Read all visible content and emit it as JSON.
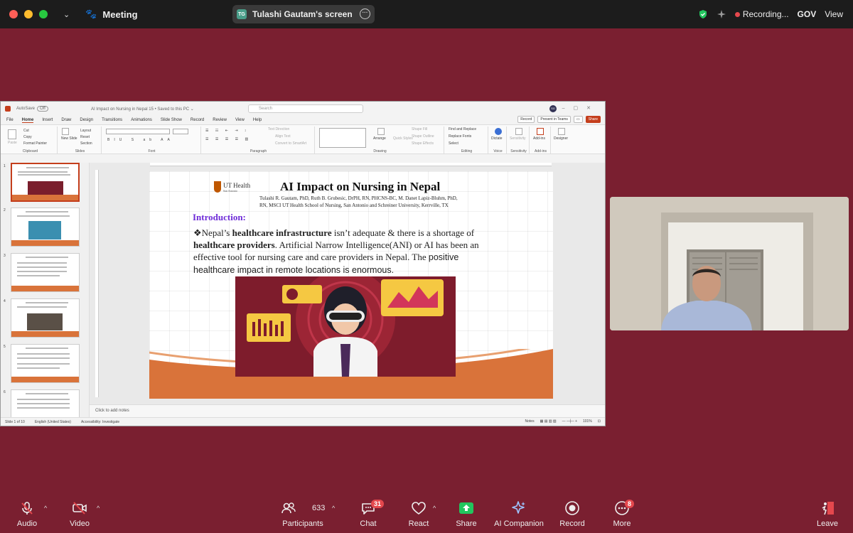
{
  "topbar": {
    "meeting_label": "Meeting",
    "share_initials": "TG",
    "share_label": "Tulashi Gautam's screen",
    "recording_label": "Recording...",
    "gov_label": "GOV",
    "view_label": "View"
  },
  "ppt": {
    "autosave_label": "AutoSave",
    "autosave_state": "Off",
    "doc_title": "AI Impact on Nursing in Nepal 15 • Saved to this PC ⌄",
    "search_placeholder": "Search",
    "user_initials": "SG",
    "menu": [
      "File",
      "Home",
      "Insert",
      "Draw",
      "Design",
      "Transitions",
      "Animations",
      "Slide Show",
      "Record",
      "Review",
      "View",
      "Help"
    ],
    "active_menu": "Home",
    "record_btn": "Record",
    "present_btn": "Present in Teams",
    "share_btn": "Share",
    "ribbon": {
      "clipboard": "Clipboard",
      "paste": "Paste",
      "cut": "Cut",
      "copy": "Copy",
      "format_painter": "Format Painter",
      "new_slide": "New Slide",
      "layout": "Layout",
      "reset": "Reset",
      "section": "Section",
      "slides": "Slides",
      "font": "Font",
      "paragraph": "Paragraph",
      "text_direction": "Text Direction",
      "align_text": "Align Text",
      "convert_smartart": "Convert to SmartArt",
      "arrange": "Arrange",
      "quick_styles": "Quick Styles",
      "shape_fill": "Shape Fill",
      "shape_outline": "Shape Outline",
      "shape_effects": "Shape Effects",
      "drawing": "Drawing",
      "find_replace": "Find and Replace",
      "replace_fonts": "Replace Fonts",
      "select": "Select",
      "editing": "Editing",
      "dictate": "Dictate",
      "voice": "Voice",
      "sensitivity": "Sensitivity",
      "addins": "Add-ins",
      "designer": "Designer"
    },
    "thumbnails": [
      "1",
      "2",
      "3",
      "4",
      "5",
      "6"
    ],
    "thumb_title": "AI Impact on Nursing in Nepal",
    "slide": {
      "logo_text": "UT Health",
      "logo_sub": "San Antonio",
      "title": "AI Impact on Nursing in Nepal",
      "authors_1": "Tulashi R. Gautam, PhD, Ruth B. Grubesic, DrPH, RN, PHCNS-BC, M. Danet Lapiz-Bluhm, PhD,",
      "authors_2": "RN, MSCI  UT Health School of Nursing, San Antonio and Schreiner University, Kerrville, TX",
      "intro_heading": "Introduction:",
      "bullet": "❖",
      "body_1": "Nepal’s ",
      "body_b1": "healthcare infrastructure",
      "body_2": " isn’t adequate & there is a shortage of ",
      "body_b2": "healthcare providers",
      "body_3": ". Artificial Narrow Intelligence(ANI) or AI has been an effective tool for nursing care and care providers in Nepal. The ",
      "body_4": "positive healthcare impact in remote locations is enormous."
    },
    "notes_placeholder": "Click to add notes",
    "status": {
      "slide_of": "Slide 1 of 10",
      "language": "English (United States)",
      "accessibility": "Accessibility: Investigate",
      "notes": "Notes",
      "zoom": "101%"
    }
  },
  "toolbar": {
    "audio": "Audio",
    "video": "Video",
    "participants": "Participants",
    "participants_count": "633",
    "chat": "Chat",
    "chat_badge": "31",
    "react": "React",
    "share": "Share",
    "ai_companion": "AI Companion",
    "record": "Record",
    "more": "More",
    "more_badge": "8",
    "leave": "Leave"
  },
  "colors": {
    "background": "#7a1f30",
    "ppt_accent": "#c43e1c",
    "intro_purple": "#6e2bd8",
    "share_green": "#22c55e",
    "record_red": "#e5484d"
  }
}
